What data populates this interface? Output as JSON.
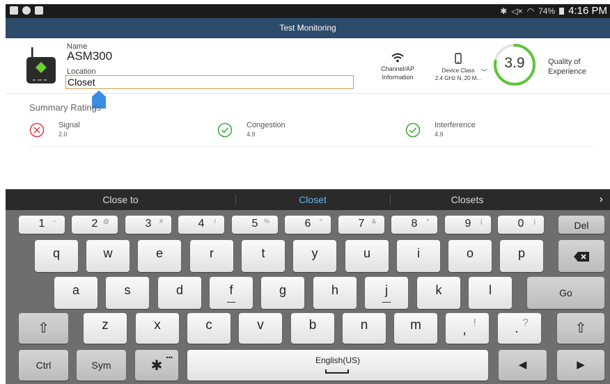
{
  "status_bar": {
    "battery": "74%",
    "time": "4:16 PM"
  },
  "header": {
    "title": "Test Monitoring"
  },
  "device": {
    "name_label": "Name",
    "name": "ASM300",
    "location_label": "Location",
    "location_value": "Closet"
  },
  "channel": {
    "line1": "Channel/AP",
    "line2": "Information"
  },
  "device_class": {
    "line1": "Device Class",
    "line2": "2.4 GHz N, 20 M..."
  },
  "qoe": {
    "value": "3.9",
    "label_line1": "Quality of",
    "label_line2": "Experience",
    "ring_fraction": 0.78
  },
  "summary": {
    "title": "Summary Ratings",
    "ratings": [
      {
        "name": "Signal",
        "value": "2.0",
        "status": "bad"
      },
      {
        "name": "Congestion",
        "value": "4.9",
        "status": "good"
      },
      {
        "name": "Interference",
        "value": "4.9",
        "status": "good"
      }
    ]
  },
  "suggestions": {
    "items": [
      "Close to",
      "Closet",
      "Closets"
    ],
    "selected": "Closet"
  },
  "keyboard": {
    "number_row": [
      {
        "main": "1",
        "sup": "~"
      },
      {
        "main": "2",
        "sup": "@"
      },
      {
        "main": "3",
        "sup": "#"
      },
      {
        "main": "4",
        "sup": "/"
      },
      {
        "main": "5",
        "sup": "%"
      },
      {
        "main": "6",
        "sup": "^"
      },
      {
        "main": "7",
        "sup": "&"
      },
      {
        "main": "8",
        "sup": "*"
      },
      {
        "main": "9",
        "sup": "("
      },
      {
        "main": "0",
        "sup": ")"
      }
    ],
    "del_label": "Del",
    "row_q": [
      "q",
      "w",
      "e",
      "r",
      "t",
      "y",
      "u",
      "i",
      "o",
      "p"
    ],
    "row_a": [
      "a",
      "s",
      "d",
      "f",
      "g",
      "h",
      "j",
      "k",
      "l"
    ],
    "go_label": "Go",
    "row_z": [
      "z",
      "x",
      "c",
      "v",
      "b",
      "n",
      "m"
    ],
    "comma_main": ",",
    "comma_sup": "!",
    "period_main": ".",
    "period_sup": "?",
    "ctrl_label": "Ctrl",
    "sym_label": "Sym",
    "space_label": "English(US)"
  },
  "colors": {
    "header_bg": "#2c4b6b",
    "ring_green": "#5ec43a",
    "bad_red": "#e0393e",
    "good_green": "#3aa53a",
    "suggestion_selected": "#5fb6e8"
  }
}
